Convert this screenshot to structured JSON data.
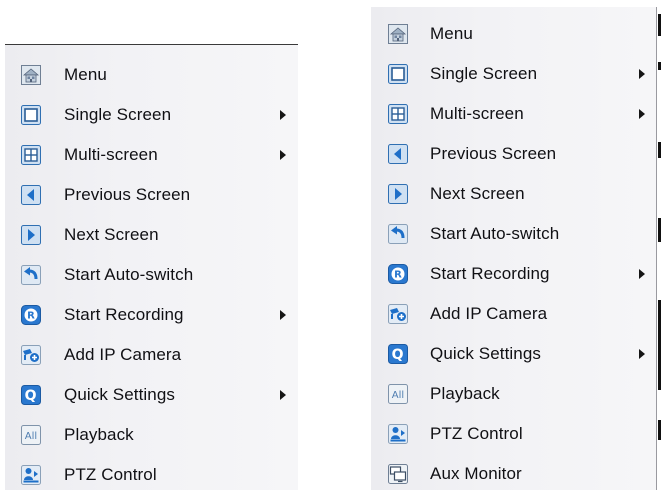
{
  "left_menu": {
    "items": [
      {
        "label": "Menu",
        "icon": "menu-home-icon",
        "has_submenu": false
      },
      {
        "label": "Single Screen",
        "icon": "single-screen-icon",
        "has_submenu": true
      },
      {
        "label": "Multi-screen",
        "icon": "multi-screen-icon",
        "has_submenu": true
      },
      {
        "label": "Previous Screen",
        "icon": "previous-screen-icon",
        "has_submenu": false
      },
      {
        "label": "Next Screen",
        "icon": "next-screen-icon",
        "has_submenu": false
      },
      {
        "label": "Start Auto-switch",
        "icon": "auto-switch-icon",
        "has_submenu": false
      },
      {
        "label": "Start Recording",
        "icon": "recording-icon",
        "has_submenu": true
      },
      {
        "label": "Add IP Camera",
        "icon": "add-ip-camera-icon",
        "has_submenu": false
      },
      {
        "label": "Quick Settings",
        "icon": "quick-settings-icon",
        "has_submenu": true
      },
      {
        "label": "Playback",
        "icon": "playback-icon",
        "has_submenu": false
      },
      {
        "label": "PTZ Control",
        "icon": "ptz-control-icon",
        "has_submenu": false
      }
    ]
  },
  "right_menu": {
    "items": [
      {
        "label": "Menu",
        "icon": "menu-home-icon",
        "has_submenu": false
      },
      {
        "label": "Single Screen",
        "icon": "single-screen-icon",
        "has_submenu": true
      },
      {
        "label": "Multi-screen",
        "icon": "multi-screen-icon",
        "has_submenu": true
      },
      {
        "label": "Previous Screen",
        "icon": "previous-screen-icon",
        "has_submenu": false
      },
      {
        "label": "Next Screen",
        "icon": "next-screen-icon",
        "has_submenu": false
      },
      {
        "label": "Start Auto-switch",
        "icon": "auto-switch-icon",
        "has_submenu": false
      },
      {
        "label": "Start Recording",
        "icon": "recording-icon",
        "has_submenu": true
      },
      {
        "label": "Add IP Camera",
        "icon": "add-ip-camera-icon",
        "has_submenu": false
      },
      {
        "label": "Quick Settings",
        "icon": "quick-settings-icon",
        "has_submenu": true
      },
      {
        "label": "Playback",
        "icon": "playback-icon",
        "has_submenu": false
      },
      {
        "label": "PTZ Control",
        "icon": "ptz-control-icon",
        "has_submenu": false
      },
      {
        "label": "Aux Monitor",
        "icon": "aux-monitor-icon",
        "has_submenu": false
      }
    ]
  },
  "colors": {
    "panel_background": "#f2f2f5",
    "text": "#101014",
    "icon_blue": "#1e6fc8",
    "icon_frame": "#6f7f94",
    "arrow": "#151515"
  }
}
